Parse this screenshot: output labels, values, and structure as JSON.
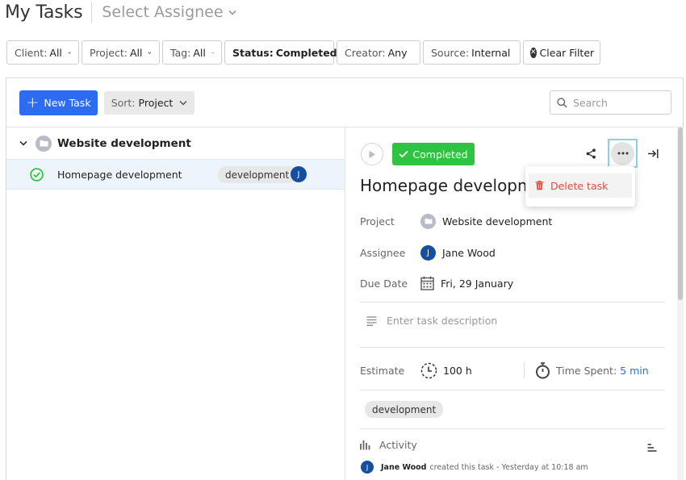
{
  "header": {
    "title": "My Tasks",
    "assignee_placeholder": "Select Assignee"
  },
  "filters": [
    {
      "key": "Client:",
      "value": "All"
    },
    {
      "key": "Project:",
      "value": "All"
    },
    {
      "key": "Tag:",
      "value": "All"
    },
    {
      "key": "Status:",
      "value": "Completed"
    },
    {
      "key": "Creator:",
      "value": "Any"
    },
    {
      "key": "Source:",
      "value": "Internal"
    }
  ],
  "clear_filter_label": "Clear Filter",
  "toolbar": {
    "new_task_label": "New Task",
    "sort_key": "Sort:",
    "sort_value": "Project",
    "search_placeholder": "Search"
  },
  "task_list": {
    "group_name": "Website development",
    "tasks": [
      {
        "name": "Homepage development",
        "tag": "development",
        "assignee_initial": "J"
      }
    ]
  },
  "detail": {
    "status_label": "Completed",
    "menu_delete_label": "Delete task",
    "title": "Homepage development",
    "fields": {
      "project_label": "Project",
      "project_value": "Website development",
      "assignee_label": "Assignee",
      "assignee_initial": "J",
      "assignee_value": "Jane Wood",
      "due_label": "Due Date",
      "due_value": "Fri, 29 January"
    },
    "description_placeholder": "Enter task description",
    "estimate_label": "Estimate",
    "estimate_value": "100 h",
    "time_spent_label": "Time Spent:",
    "time_spent_value": "5 min",
    "tag": "development",
    "activity_label": "Activity",
    "activity_log": {
      "initial": "J",
      "user": "Jane Wood",
      "action": "created this task - Yesterday at 10:18 am"
    }
  },
  "colors": {
    "primary": "#2d6cf0",
    "success": "#2ec340",
    "danger": "#e04b3a",
    "avatar": "#14509e"
  }
}
